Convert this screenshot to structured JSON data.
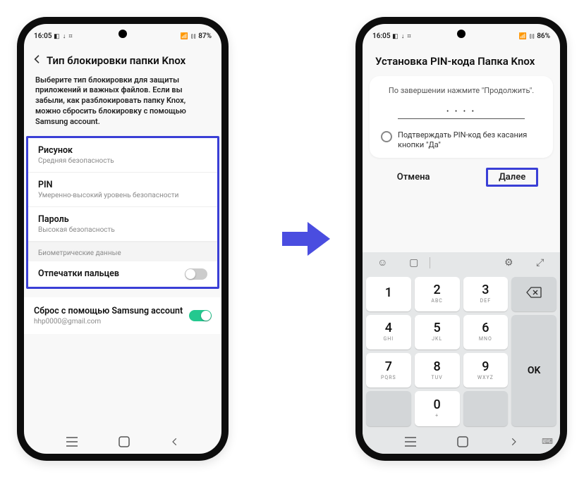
{
  "phone1": {
    "status": {
      "time": "16:05",
      "left_icons": "◧ ↓ ⌗",
      "right_icons": "📶 ⫾⫾",
      "battery": "87%"
    },
    "header": {
      "title": "Тип блокировки папки Knox"
    },
    "description": "Выберите тип блокировки для защиты приложений и важных файлов. Если вы забыли, как разблокировать папку Knox, можно сбросить блокировку с помощью Samsung account.",
    "options": [
      {
        "title": "Рисунок",
        "sub": "Средняя безопасность"
      },
      {
        "title": "PIN",
        "sub": "Умеренно-высокий уровень безопасности"
      },
      {
        "title": "Пароль",
        "sub": "Высокая безопасность"
      }
    ],
    "biometric_label": "Биометрические данные",
    "fingerprint_label": "Отпечатки пальцев",
    "reset": {
      "title": "Сброс с помощью Samsung account",
      "sub": "hhp0000@gmail.com"
    }
  },
  "phone2": {
    "status": {
      "time": "16:05",
      "left_icons": "◧ ↓ ⌗",
      "right_icons": "📶 ⫾⫾",
      "battery": "86%"
    },
    "title": "Установка PIN-кода Папка Knox",
    "hint": "По завершении нажмите \"Продолжить\".",
    "pin_mask": "• • • •",
    "confirm_text": "Подтверждать PIN-код без касания кнопки \"Да\"",
    "cancel": "Отмена",
    "next": "Далее",
    "keys": {
      "k1": {
        "n": "1",
        "l": ""
      },
      "k2": {
        "n": "2",
        "l": "ABC"
      },
      "k3": {
        "n": "3",
        "l": "DEF"
      },
      "k4": {
        "n": "4",
        "l": "GHI"
      },
      "k5": {
        "n": "5",
        "l": "JKL"
      },
      "k6": {
        "n": "6",
        "l": "MNO"
      },
      "k7": {
        "n": "7",
        "l": "PQRS"
      },
      "k8": {
        "n": "8",
        "l": "TUV"
      },
      "k9": {
        "n": "9",
        "l": "WXYZ"
      },
      "k0": {
        "n": "0",
        "l": "+"
      },
      "ok": "OK"
    }
  }
}
